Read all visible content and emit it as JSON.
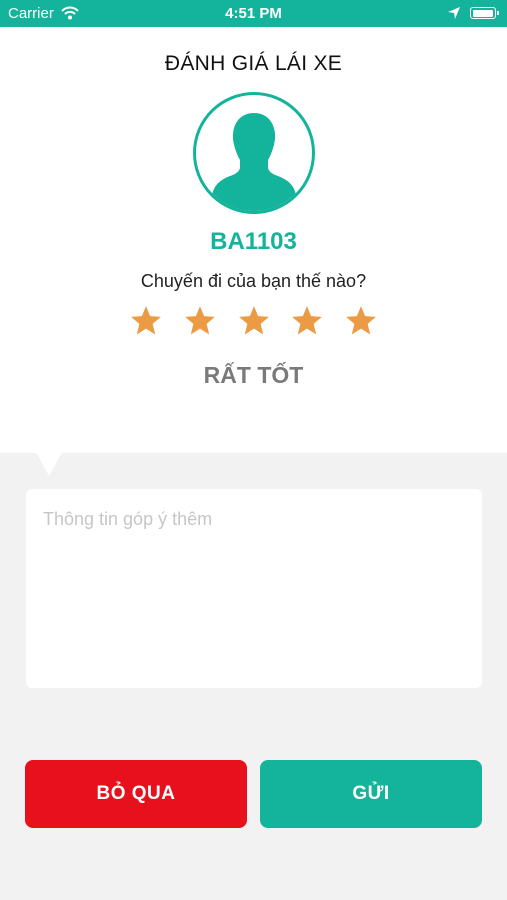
{
  "status_bar": {
    "carrier": "Carrier",
    "time": "4:51 PM",
    "wifi_icon": "wifi-icon",
    "location_icon": "location-arrow-icon",
    "battery_icon": "battery-icon"
  },
  "header": {
    "title": "ĐÁNH GIÁ LÁI XE"
  },
  "driver": {
    "code": "BA1103",
    "avatar_icon": "user-silhouette-icon"
  },
  "rating": {
    "question": "Chuyến đi của bạn thế nào?",
    "stars_selected": 5,
    "stars_total": 5,
    "label": "RẤT TỐT"
  },
  "feedback": {
    "placeholder": "Thông tin góp ý thêm",
    "value": ""
  },
  "actions": {
    "skip_label": "BỎ QUA",
    "send_label": "GỬI"
  },
  "colors": {
    "accent": "#14b39b",
    "danger": "#e8101c",
    "star": "#ec9b45",
    "background": "#f2f2f2"
  }
}
